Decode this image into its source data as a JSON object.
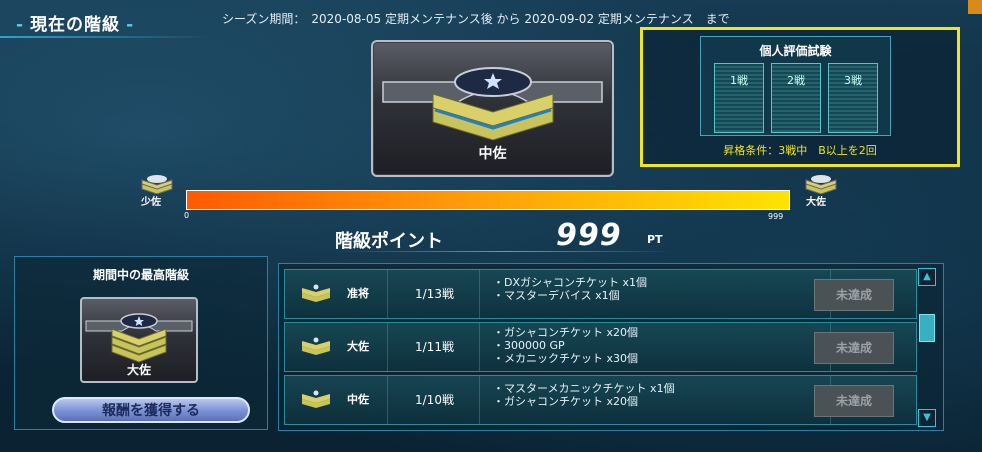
{
  "header": {
    "title": "現在の階級"
  },
  "season": {
    "text": "シーズン期間：　2020-08-05 定期メンテナンス後 から 2020-09-02 定期メンテナンス　まで"
  },
  "current_rank": {
    "name": "中佐"
  },
  "trial": {
    "title": "個人評価試験",
    "slots": [
      "1戦",
      "2戦",
      "3戦"
    ],
    "condition": "昇格条件：3戦中　B以上を2回"
  },
  "progress": {
    "lower_rank": "少佐",
    "upper_rank": "大佐",
    "min_label": "0",
    "max_label": "999",
    "value": 999,
    "max": 999
  },
  "points": {
    "label": "階級ポイント",
    "value": "999",
    "unit": "PT"
  },
  "highest": {
    "title": "期間中の最高階級",
    "rank": "大佐",
    "button": "報酬を獲得する"
  },
  "rewards": [
    {
      "rank": "准将",
      "battles": "1/13戦",
      "items": [
        "・DXガシャコンチケット x1個",
        "・マスターデバイス x1個"
      ],
      "status": "未達成"
    },
    {
      "rank": "大佐",
      "battles": "1/11戦",
      "items": [
        "・ガシャコンチケット x20個",
        "・300000 GP",
        "・メカニックチケット x30個"
      ],
      "status": "未達成"
    },
    {
      "rank": "中佐",
      "battles": "1/10戦",
      "items": [
        "・マスターメカニックチケット x1個",
        "・ガシャコンチケット x20個"
      ],
      "status": "未達成"
    }
  ],
  "icons": {
    "scroll_up": "triangle-up-icon",
    "scroll_down": "triangle-down-icon",
    "rank_emblem": "chevron-star-emblem"
  },
  "colors": {
    "highlight": "#f2e51b",
    "accent": "#2fa3cf",
    "bar_start": "#ff5a00",
    "bar_end": "#ffe300"
  }
}
